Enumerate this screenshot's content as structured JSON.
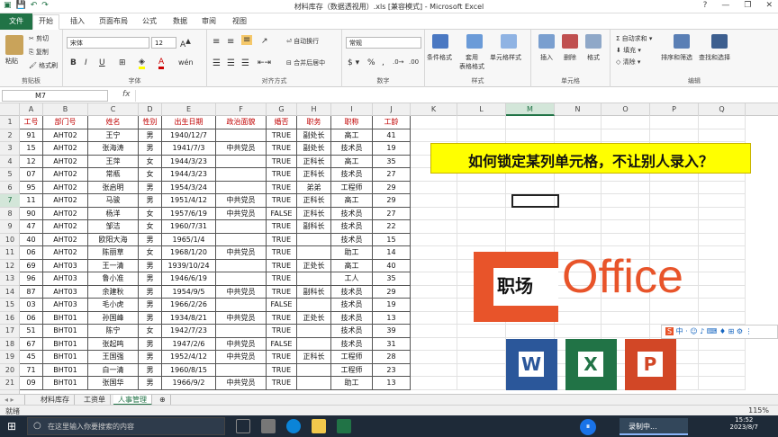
{
  "title": "材料库存（数据透视用）.xls [兼容模式] - Microsoft Excel",
  "window_controls": [
    "?",
    "—",
    "❐",
    "✕"
  ],
  "tabs": [
    "文件",
    "开始",
    "插入",
    "页面布局",
    "公式",
    "数据",
    "审阅",
    "视图"
  ],
  "ribbon": {
    "clipboard": {
      "paste": "粘贴",
      "cut": "剪切",
      "copy": "复制",
      "format_painter": "格式刷",
      "label": "剪贴板"
    },
    "font": {
      "name": "宋体",
      "size": "12",
      "label": "字体",
      "bold": "B",
      "italic": "I",
      "underline": "U"
    },
    "alignment": {
      "wrap": "自动换行",
      "merge": "合并后居中",
      "label": "对齐方式"
    },
    "number": {
      "format": "常规",
      "label": "数字"
    },
    "styles": {
      "conditional": "条件格式",
      "table": "套用\n表格格式",
      "cell_styles": "单元格样式",
      "label": "样式"
    },
    "cells": {
      "insert": "插入",
      "delete": "删除",
      "format": "格式",
      "label": "单元格"
    },
    "editing": {
      "autosum": "自动求和",
      "fill": "填充",
      "clear": "清除",
      "sort": "排序和筛选",
      "find": "查找和选择",
      "label": "编辑"
    }
  },
  "namebox": "M7",
  "fx": "fx",
  "columns": [
    "A",
    "B",
    "C",
    "D",
    "E",
    "F",
    "G",
    "H",
    "I",
    "J",
    "K",
    "L",
    "M",
    "N",
    "O",
    "P",
    "Q"
  ],
  "selected_col": "M",
  "selected_row": 7,
  "rows": [
    {
      "n": 1,
      "c": [
        "工号",
        "部门号",
        "姓名",
        "性别",
        "出生日期",
        "政治面貌",
        "婚否",
        "职务",
        "职称",
        "工龄"
      ]
    },
    {
      "n": 2,
      "c": [
        "91",
        "AHT02",
        "王宁",
        "男",
        "1940/12/7",
        "",
        "TRUE",
        "副处长",
        "高工",
        "41"
      ]
    },
    {
      "n": 3,
      "c": [
        "15",
        "AHT02",
        "张海涛",
        "男",
        "1941/7/3",
        "中共党员",
        "TRUE",
        "副处长",
        "技术员",
        "19"
      ]
    },
    {
      "n": 4,
      "c": [
        "12",
        "AHT02",
        "王萍",
        "女",
        "1944/3/23",
        "",
        "TRUE",
        "正科长",
        "高工",
        "35"
      ]
    },
    {
      "n": 5,
      "c": [
        "07",
        "AHT02",
        "常瓶",
        "女",
        "1944/3/23",
        "",
        "TRUE",
        "正科长",
        "技术员",
        "27"
      ]
    },
    {
      "n": 6,
      "c": [
        "95",
        "AHT02",
        "张启明",
        "男",
        "1954/3/24",
        "",
        "TRUE",
        "弟弟",
        "工程师",
        "29"
      ]
    },
    {
      "n": 7,
      "c": [
        "11",
        "AHT02",
        "马骏",
        "男",
        "1951/4/12",
        "中共党员",
        "TRUE",
        "正科长",
        "高工",
        "29"
      ]
    },
    {
      "n": 8,
      "c": [
        "90",
        "AHT02",
        "杨洋",
        "女",
        "1957/6/19",
        "中共党员",
        "FALSE",
        "正科长",
        "技术员",
        "27"
      ]
    },
    {
      "n": 9,
      "c": [
        "47",
        "AHT02",
        "邹洁",
        "女",
        "1960/7/31",
        "",
        "TRUE",
        "副科长",
        "技术员",
        "22"
      ]
    },
    {
      "n": 10,
      "c": [
        "40",
        "AHT02",
        "欧阳大海",
        "男",
        "1965/1/4",
        "",
        "TRUE",
        "",
        "技术员",
        "15"
      ]
    },
    {
      "n": 11,
      "c": [
        "06",
        "AHT02",
        "陈丽草",
        "女",
        "1968/1/20",
        "中共党员",
        "TRUE",
        "",
        "助工",
        "14"
      ]
    },
    {
      "n": 12,
      "c": [
        "69",
        "AHT03",
        "王一清",
        "男",
        "1939/10/24",
        "",
        "TRUE",
        "正处长",
        "高工",
        "40"
      ]
    },
    {
      "n": 13,
      "c": [
        "96",
        "AHT03",
        "鲁小准",
        "男",
        "1946/6/19",
        "",
        "TRUE",
        "",
        "工人",
        "35"
      ]
    },
    {
      "n": 14,
      "c": [
        "87",
        "AHT03",
        "余建秋",
        "男",
        "1954/9/5",
        "中共党员",
        "TRUE",
        "副科长",
        "技术员",
        "29"
      ]
    },
    {
      "n": 15,
      "c": [
        "03",
        "AHT03",
        "毛小虎",
        "男",
        "1966/2/26",
        "",
        "FALSE",
        "",
        "技术员",
        "19"
      ]
    },
    {
      "n": 16,
      "c": [
        "06",
        "BHT01",
        "孙国峰",
        "男",
        "1934/8/21",
        "中共党员",
        "TRUE",
        "正处长",
        "技术员",
        "13"
      ]
    },
    {
      "n": 17,
      "c": [
        "51",
        "BHT01",
        "陈宁",
        "女",
        "1942/7/23",
        "",
        "TRUE",
        "",
        "技术员",
        "39"
      ]
    },
    {
      "n": 18,
      "c": [
        "67",
        "BHT01",
        "张起鸣",
        "男",
        "1947/2/6",
        "中共党员",
        "FALSE",
        "",
        "技术员",
        "31"
      ]
    },
    {
      "n": 19,
      "c": [
        "45",
        "BHT01",
        "王国强",
        "男",
        "1952/4/12",
        "中共党员",
        "TRUE",
        "正科长",
        "工程师",
        "28"
      ]
    },
    {
      "n": 20,
      "c": [
        "71",
        "BHT01",
        "白一清",
        "男",
        "1960/8/15",
        "",
        "TRUE",
        "",
        "工程师",
        "23"
      ]
    },
    {
      "n": 21,
      "c": [
        "09",
        "BHT01",
        "张国华",
        "男",
        "1966/9/2",
        "中共党员",
        "TRUE",
        "",
        "助工",
        "13"
      ]
    }
  ],
  "banner": "如何锁定某列单元格，不让别人录入？",
  "logo": {
    "zc": "职场",
    "office": "Office"
  },
  "apps": [
    "W",
    "X",
    "P"
  ],
  "ime_text": "中 · ☺ ♪ ⌨ ♦ ⊞ ⚙ ⋮",
  "sheets": [
    "材料库存",
    "工资单",
    "人事管理"
  ],
  "active_sheet": "人事管理",
  "status": "就绪",
  "zoom": "115%",
  "taskbar": {
    "search_placeholder": "在这里输入你要搜索的内容",
    "recording": "录制中...",
    "clock_time": "15:52",
    "clock_date": "2023/8/7"
  }
}
